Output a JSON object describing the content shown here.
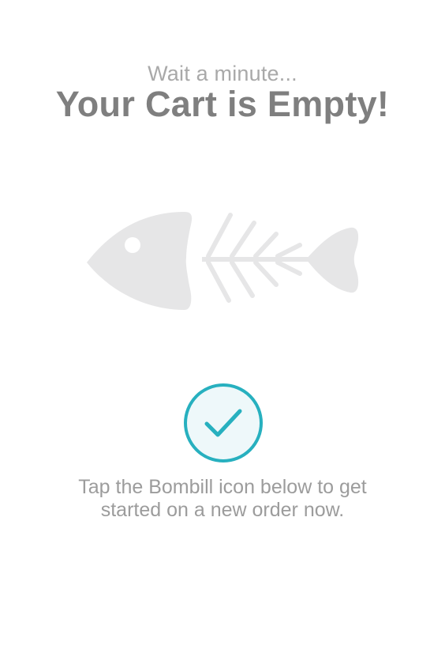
{
  "empty_cart": {
    "subtitle": "Wait a minute...",
    "title": "Your Cart is Empty!",
    "illustration_icon": "fish-bones-icon",
    "badge_icon": "checkmark-icon",
    "message_line1": "Tap the Bombill icon below to get",
    "message_line2": "started on a new order now."
  },
  "colors": {
    "background": "#ffffff",
    "title": "#7f7f7f",
    "subtitle": "#a9a9a9",
    "message": "#9c9c9c",
    "illustration": "#e6e6e7",
    "accent": "#27b0bf",
    "badge_fill": "#eef8fa"
  }
}
